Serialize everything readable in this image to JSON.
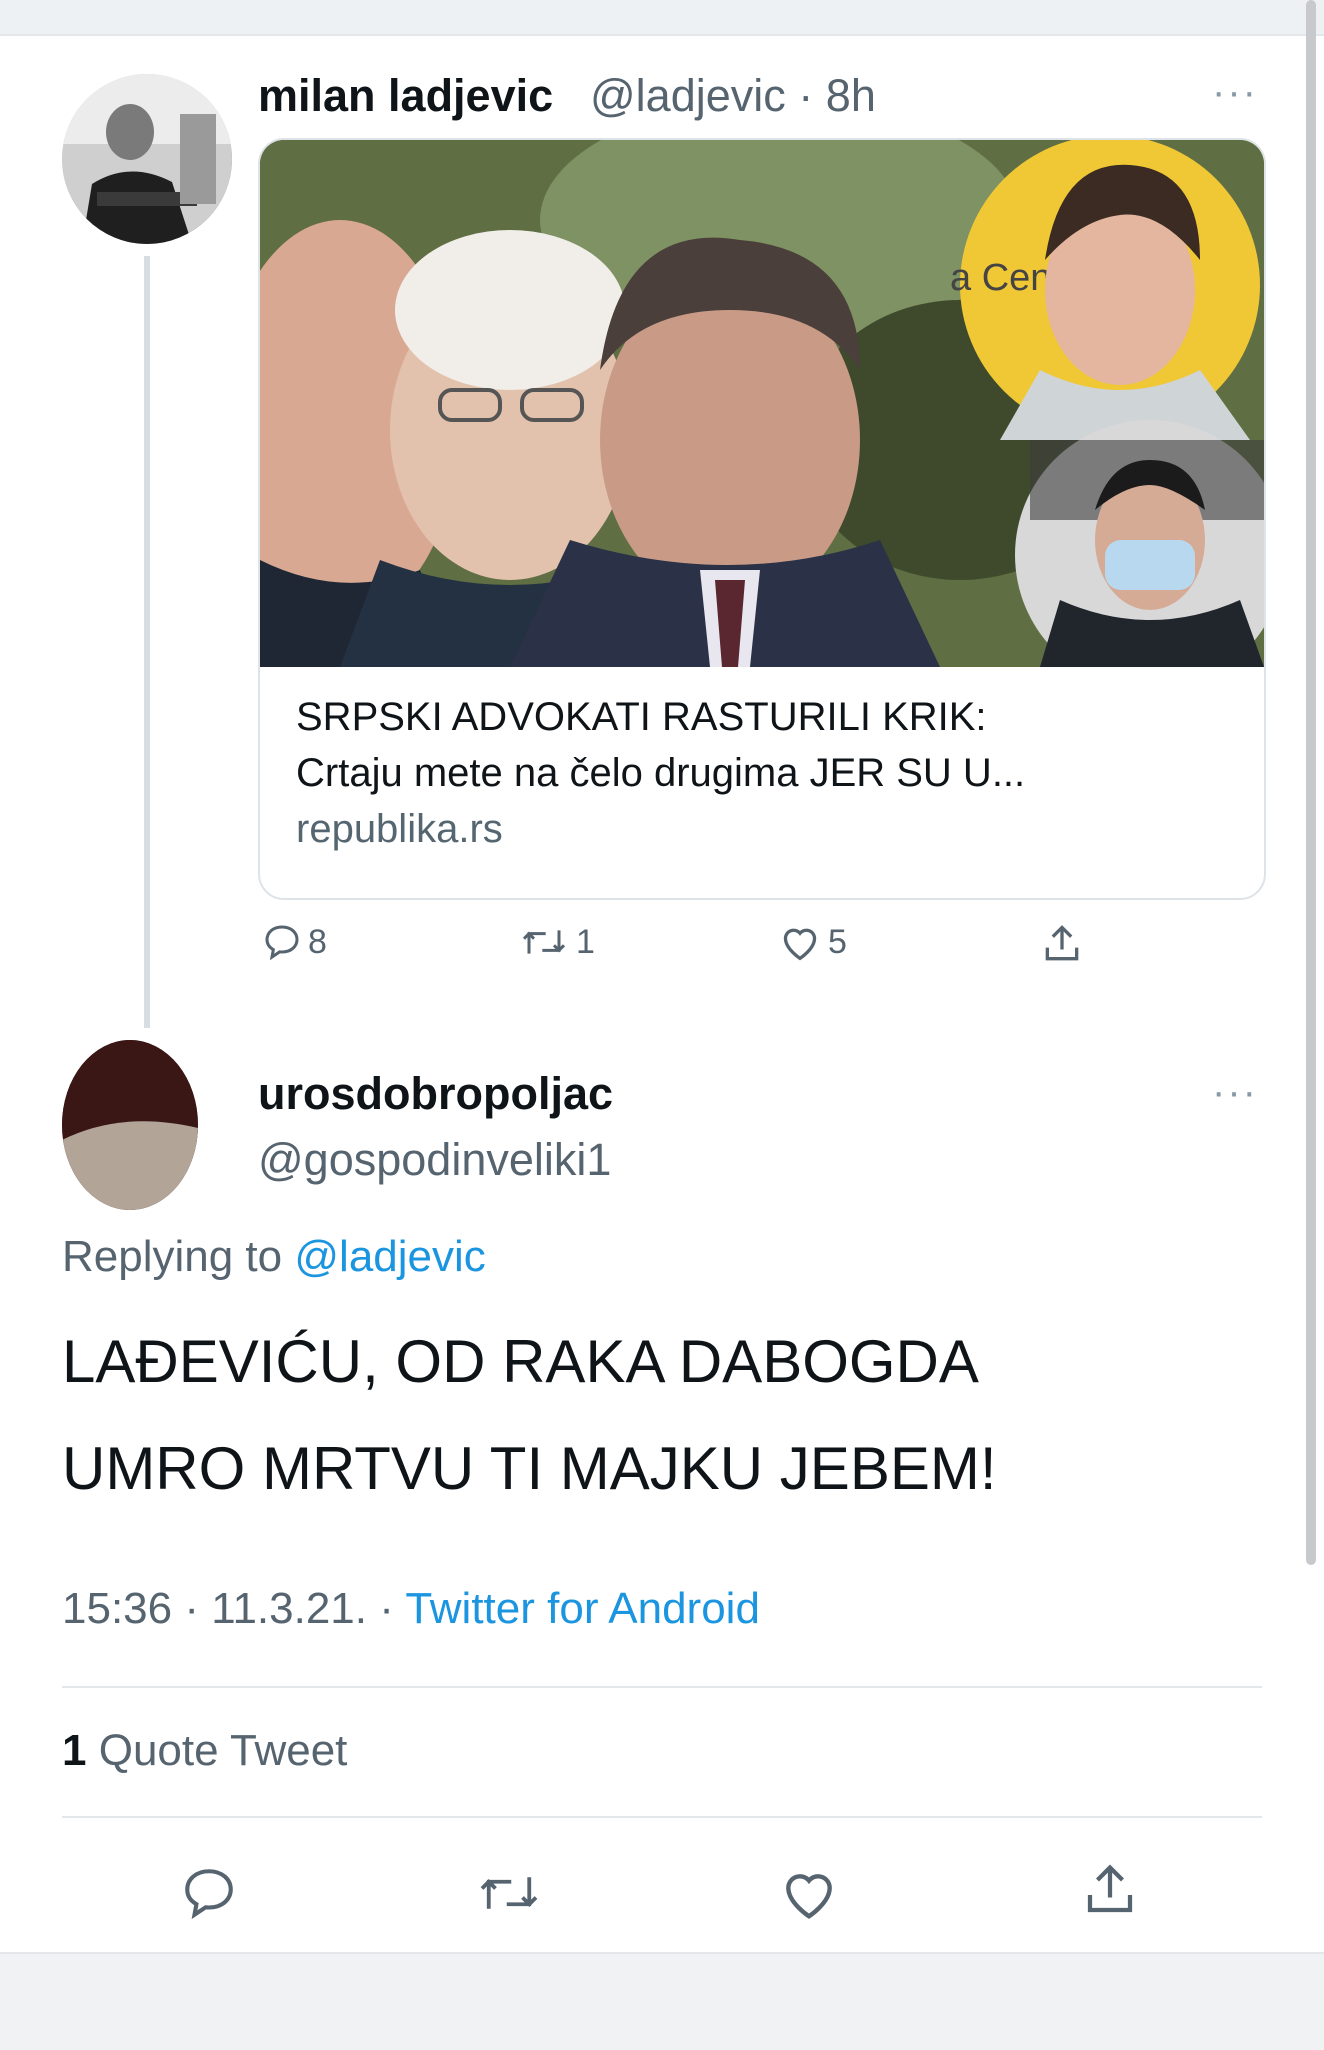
{
  "original_tweet": {
    "author_name": "milan ladjevic",
    "author_handle": "@ladjevic",
    "separator": "·",
    "time_ago": "8h",
    "more_label": "···",
    "link_card": {
      "image_description_icon": "news-collage-photo",
      "headline_line1": "SRPSKI ADVOKATI RASTURILI KRIK:",
      "headline_line2": "Crtaju mete na čelo drugima JER SU U...",
      "domain": "republika.rs"
    },
    "actions": {
      "reply_count": "8",
      "retweet_count": "1",
      "like_count": "5"
    }
  },
  "reply_tweet": {
    "author_name": "urosdobropoljac",
    "author_handle": "@gospodinveliki1",
    "more_label": "···",
    "replying_to_label": "Replying to",
    "replying_to_handle": "@ladjevic",
    "text_line1": "LAĐEVIĆU, OD RAKA DABOGDA",
    "text_line2": "UMRO MRTVU TI MAJKU JEBEM!",
    "time": "15:36",
    "separator": "·",
    "date": "11.3.21.",
    "separator2": "·",
    "source_app": "Twitter for Android",
    "quote_count": "1",
    "quote_label": "Quote Tweet"
  },
  "colors": {
    "link_blue": "#1b95e0",
    "secondary_text": "#566470",
    "primary_text": "#0f1419"
  }
}
